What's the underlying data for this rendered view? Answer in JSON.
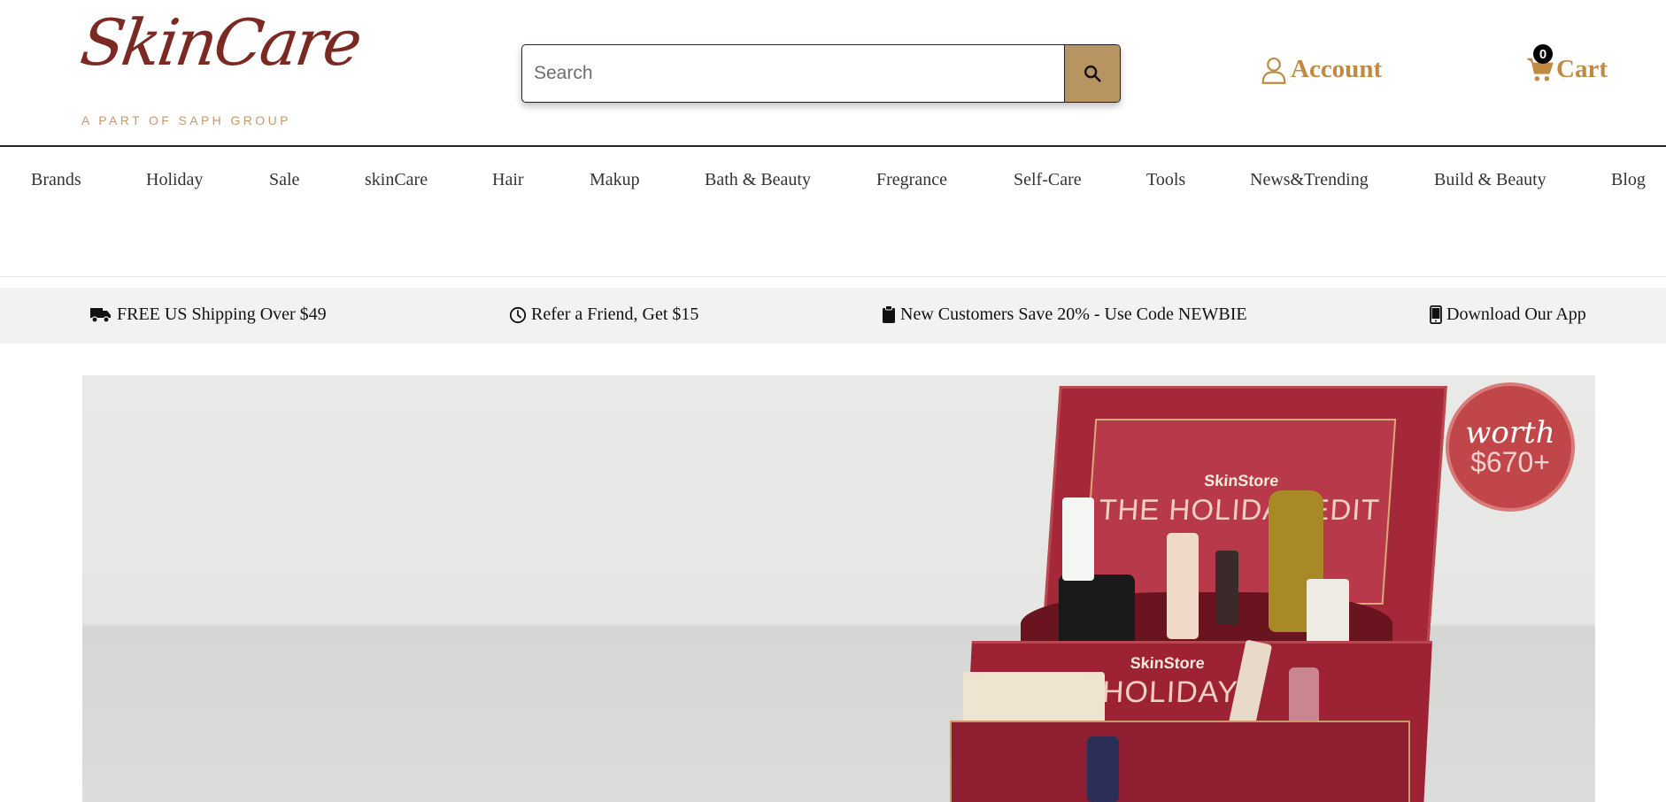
{
  "header": {
    "logo_text": "SkinCare",
    "logo_tagline": "A PART OF SAPH GROUP",
    "search": {
      "placeholder": "Search",
      "value": "",
      "button_icon": "search-icon"
    },
    "account": {
      "label": "Account",
      "icon": "user-icon"
    },
    "cart": {
      "label": "Cart",
      "count": "0",
      "icon": "cart-icon"
    },
    "accent_color": "#c08a44"
  },
  "nav": {
    "items": [
      {
        "label": "Brands"
      },
      {
        "label": "Holiday"
      },
      {
        "label": "Sale"
      },
      {
        "label": "skinCare"
      },
      {
        "label": "Hair"
      },
      {
        "label": "Makup"
      },
      {
        "label": "Bath & Beauty"
      },
      {
        "label": "Fregrance"
      },
      {
        "label": "Self-Care"
      },
      {
        "label": "Tools"
      },
      {
        "label": "News&Trending"
      },
      {
        "label": "Build & Beauty"
      },
      {
        "label": "Blog"
      }
    ]
  },
  "promo": {
    "items": [
      {
        "icon": "truck-icon",
        "text": "FREE US Shipping Over $49"
      },
      {
        "icon": "clock-icon",
        "text": "Refer a Friend, Get $15"
      },
      {
        "icon": "clipboard-icon",
        "text": "New Customers Save 20% - Use Code NEWBIE"
      },
      {
        "icon": "mobile-icon",
        "text": "Download Our App"
      }
    ]
  },
  "hero": {
    "lid_brand": "SkinStore",
    "lid_title": "THE HOLIDAY EDIT",
    "base_brand": "SkinStore",
    "base_title": "HOLIDAY",
    "seal_worth": "worth",
    "seal_price": "$670+",
    "box_color": "#a4283a"
  }
}
